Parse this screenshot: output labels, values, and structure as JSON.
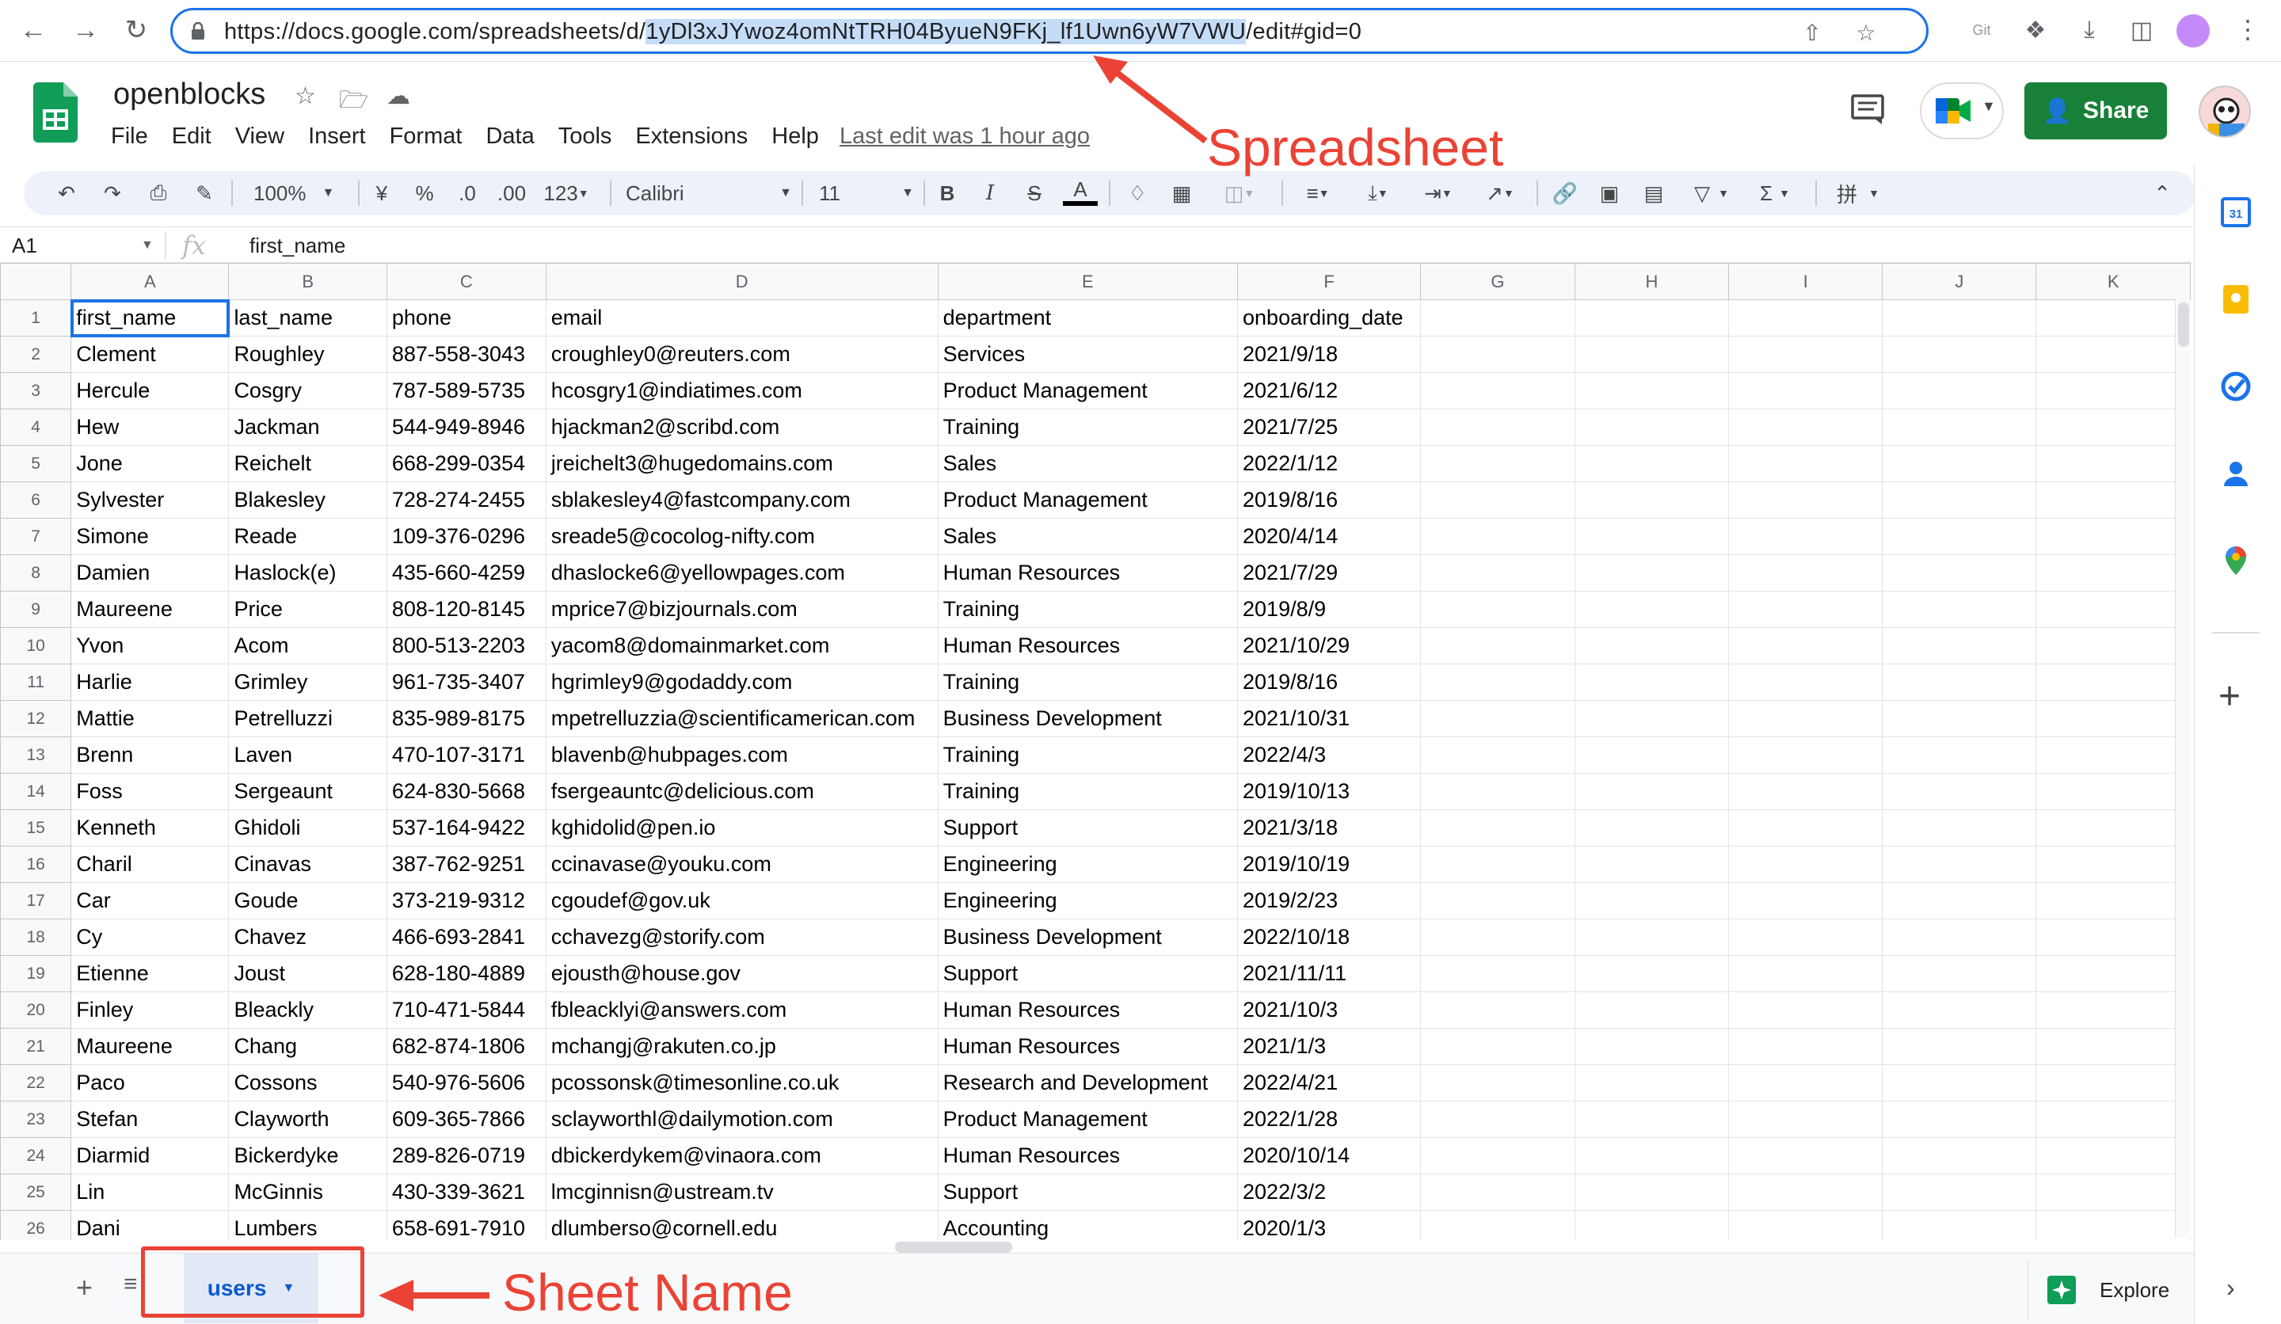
{
  "browser": {
    "url_prefix": "https://docs.google.com/spreadsheets/d/",
    "url_id": "1yDl3xJYwoz4omNtTRH04ByueN9FKj_lf1Uwn6yW7VWU",
    "url_suffix": "/edit#gid=0"
  },
  "doc": {
    "title": "openblocks",
    "menu": [
      "File",
      "Edit",
      "View",
      "Insert",
      "Format",
      "Data",
      "Tools",
      "Extensions",
      "Help"
    ],
    "last_edit": "Last edit was 1 hour ago",
    "share_label": "Share"
  },
  "toolbar": {
    "zoom": "100%",
    "currency": "¥",
    "percent": "%",
    "decrease_decimal": ".0",
    "increase_decimal": ".00",
    "more_formats": "123",
    "font": "Calibri",
    "font_size": "11",
    "bold": "B",
    "italic": "I",
    "strikethrough": "S",
    "text_color": "A"
  },
  "formula_bar": {
    "cell_ref": "A1",
    "fx": "fx",
    "content": "first_name"
  },
  "grid": {
    "col_letters": [
      "A",
      "B",
      "C",
      "D",
      "E",
      "F",
      "G",
      "H",
      "I",
      "J",
      "K"
    ],
    "header": [
      "first_name",
      "last_name",
      "phone",
      "email",
      "department",
      "onboarding_date"
    ],
    "rows": [
      [
        "Clement",
        "Roughley",
        "887-558-3043",
        "croughley0@reuters.com",
        "Services",
        "2021/9/18"
      ],
      [
        "Hercule",
        "Cosgry",
        "787-589-5735",
        "hcosgry1@indiatimes.com",
        "Product Management",
        "2021/6/12"
      ],
      [
        "Hew",
        "Jackman",
        "544-949-8946",
        "hjackman2@scribd.com",
        "Training",
        "2021/7/25"
      ],
      [
        "Jone",
        "Reichelt",
        "668-299-0354",
        "jreichelt3@hugedomains.com",
        "Sales",
        "2022/1/12"
      ],
      [
        "Sylvester",
        "Blakesley",
        "728-274-2455",
        "sblakesley4@fastcompany.com",
        "Product Management",
        "2019/8/16"
      ],
      [
        "Simone",
        "Reade",
        "109-376-0296",
        "sreade5@cocolog-nifty.com",
        "Sales",
        "2020/4/14"
      ],
      [
        "Damien",
        "Haslock(e)",
        "435-660-4259",
        "dhaslocke6@yellowpages.com",
        "Human Resources",
        "2021/7/29"
      ],
      [
        "Maureene",
        "Price",
        "808-120-8145",
        "mprice7@bizjournals.com",
        "Training",
        "2019/8/9"
      ],
      [
        "Yvon",
        "Acom",
        "800-513-2203",
        "yacom8@domainmarket.com",
        "Human Resources",
        "2021/10/29"
      ],
      [
        "Harlie",
        "Grimley",
        "961-735-3407",
        "hgrimley9@godaddy.com",
        "Training",
        "2019/8/16"
      ],
      [
        "Mattie",
        "Petrelluzzi",
        "835-989-8175",
        "mpetrelluzzia@scientificamerican.com",
        "Business Development",
        "2021/10/31"
      ],
      [
        "Brenn",
        "Laven",
        "470-107-3171",
        "blavenb@hubpages.com",
        "Training",
        "2022/4/3"
      ],
      [
        "Foss",
        "Sergeaunt",
        "624-830-5668",
        "fsergeauntc@delicious.com",
        "Training",
        "2019/10/13"
      ],
      [
        "Kenneth",
        "Ghidoli",
        "537-164-9422",
        "kghidolid@pen.io",
        "Support",
        "2021/3/18"
      ],
      [
        "Charil",
        "Cinavas",
        "387-762-9251",
        "ccinavase@youku.com",
        "Engineering",
        "2019/10/19"
      ],
      [
        "Car",
        "Goude",
        "373-219-9312",
        "cgoudef@gov.uk",
        "Engineering",
        "2019/2/23"
      ],
      [
        "Cy",
        "Chavez",
        "466-693-2841",
        "cchavezg@storify.com",
        "Business Development",
        "2022/10/18"
      ],
      [
        "Etienne",
        "Joust",
        "628-180-4889",
        "ejousth@house.gov",
        "Support",
        "2021/11/11"
      ],
      [
        "Finley",
        "Bleackly",
        "710-471-5844",
        "fbleacklyi@answers.com",
        "Human Resources",
        "2021/10/3"
      ],
      [
        "Maureene",
        "Chang",
        "682-874-1806",
        "mchangj@rakuten.co.jp",
        "Human Resources",
        "2021/1/3"
      ],
      [
        "Paco",
        "Cossons",
        "540-976-5606",
        "pcossonsk@timesonline.co.uk",
        "Research and Development",
        "2022/4/21"
      ],
      [
        "Stefan",
        "Clayworth",
        "609-365-7866",
        "sclayworthl@dailymotion.com",
        "Product Management",
        "2022/1/28"
      ],
      [
        "Diarmid",
        "Bickerdyke",
        "289-826-0719",
        "dbickerdykem@vinaora.com",
        "Human Resources",
        "2020/10/14"
      ],
      [
        "Lin",
        "McGinnis",
        "430-339-3621",
        "lmcginnisn@ustream.tv",
        "Support",
        "2022/3/2"
      ],
      [
        "Dani",
        "Lumbers",
        "658-691-7910",
        "dlumberso@cornell.edu",
        "Accounting",
        "2020/1/3"
      ]
    ]
  },
  "sheets": {
    "active_tab": "users",
    "explore_label": "Explore"
  },
  "annotations": {
    "spreadsheet": "Spreadsheet",
    "sheet_name": "Sheet Name"
  },
  "colors": {
    "accent": "#1a73e8",
    "share": "#188038",
    "annotation": "#ea4335",
    "sheets_green": "#0f9d58"
  }
}
